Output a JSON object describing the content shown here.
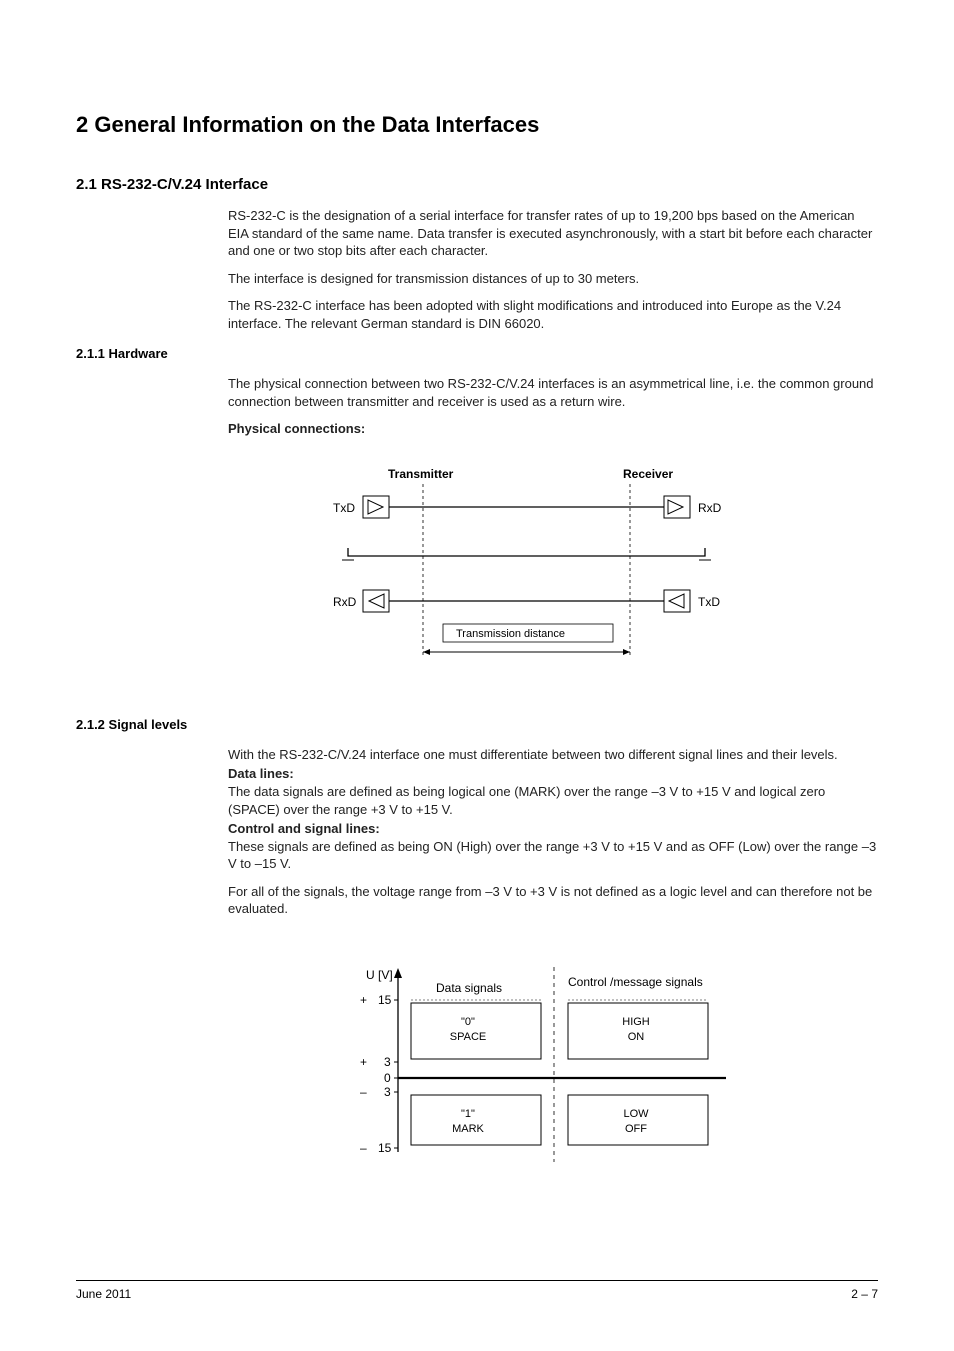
{
  "chapter": {
    "title": "2 General Information on the Data Interfaces"
  },
  "section_2_1": {
    "title": "2.1 RS-232-C/V.24 Interface",
    "para1": "RS-232-C is the designation of a serial interface for transfer rates of up to 19,200 bps based on the American EIA standard of the same name. Data transfer is executed asynchronously, with a start bit before each character and one or two stop bits after each character.",
    "para2": "The interface is designed for transmission distances of up to 30 meters.",
    "para3": "The RS-232-C interface has been adopted with slight modifications and introduced into Europe as the V.24 interface. The relevant German standard is DIN 66020."
  },
  "section_2_1_1": {
    "title": "2.1.1 Hardware",
    "para1": "The physical connection between two RS-232-C/V.24 interfaces is an asymmetrical line, i.e. the common ground connection between transmitter and receiver is used as a return wire.",
    "bold1": "Physical connections:"
  },
  "diagram1": {
    "transmitter": "Transmitter",
    "receiver": "Receiver",
    "txd": "TxD",
    "rxd": "RxD",
    "distance": "Transmission distance"
  },
  "section_2_1_2": {
    "title": "2.1.2 Signal levels",
    "para1": "With the RS-232-C/V.24 interface one must differentiate between two different signal lines and their levels.",
    "bold_data": "Data lines:",
    "para_data": "The data signals are defined as being logical one (MARK) over the range –3 V to +15 V and logical zero (SPACE) over the range +3 V to +15 V.",
    "bold_control": "Control and signal lines:",
    "para_control": "These signals are defined as being ON (High) over the range +3 V to +15 V and as OFF (Low) over the range –3 V to –15 V.",
    "para2": "For all of the signals, the voltage range from –3 V to +3 V is not defined as a logic level and can therefore not be evaluated."
  },
  "diagram2": {
    "ylabel": "U [V]",
    "y_plus15": "15",
    "y_plus3": "3",
    "y_0": "0",
    "y_minus3": "3",
    "y_minus15": "15",
    "plus": "+",
    "minus": "–",
    "data_signals": "Data signals",
    "control_signals": "Control /message signals",
    "zero": "\"0\"",
    "space": "SPACE",
    "one": "\"1\"",
    "mark": "MARK",
    "high": "HIGH",
    "on": "ON",
    "low": "LOW",
    "off": "OFF"
  },
  "footer": {
    "date": "June 2011",
    "page": "2 – 7"
  }
}
